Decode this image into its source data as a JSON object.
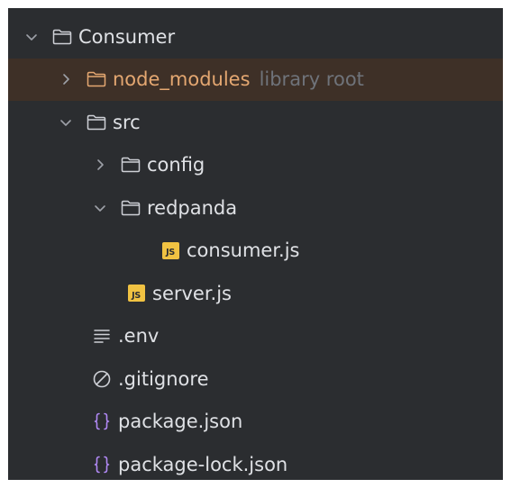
{
  "tree": {
    "items": [
      {
        "label": "Consumer",
        "icon": "folder-icon",
        "arrow": "expanded"
      },
      {
        "label": "node_modules",
        "hint": "library root",
        "icon": "folder-icon",
        "arrow": "collapsed"
      },
      {
        "label": "src",
        "icon": "folder-icon",
        "arrow": "expanded"
      },
      {
        "label": "config",
        "icon": "folder-icon",
        "arrow": "collapsed"
      },
      {
        "label": "redpanda",
        "icon": "folder-icon",
        "arrow": "expanded"
      },
      {
        "label": "consumer.js",
        "icon": "js-file-icon",
        "badge": "JS"
      },
      {
        "label": "server.js",
        "icon": "js-file-icon",
        "badge": "JS"
      },
      {
        "label": ".env",
        "icon": "text-lines-icon"
      },
      {
        "label": ".gitignore",
        "icon": "ignored-file-icon"
      },
      {
        "label": "package.json",
        "icon": "braces-icon"
      },
      {
        "label": "package-lock.json",
        "icon": "braces-icon"
      }
    ]
  },
  "colors": {
    "background": "#2b2d30",
    "text": "#dfe1e5",
    "excluded_folder": "#e4a771",
    "hint": "#6f737a",
    "selected_row": "#3e3027",
    "js_badge": "#f0c242",
    "json_icon": "#b189f5"
  }
}
